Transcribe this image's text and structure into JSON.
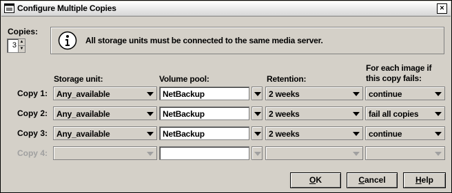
{
  "window": {
    "title": "Configure Multiple Copies",
    "close_glyph": "×"
  },
  "copies": {
    "label": "Copies:",
    "value": "3"
  },
  "info": {
    "message": "All storage units must be connected to the same media server."
  },
  "headers": {
    "storage_unit": "Storage unit:",
    "volume_pool": "Volume pool:",
    "retention": "Retention:",
    "on_fail_line1": "For each image if",
    "on_fail_line2": "this copy fails:"
  },
  "rows": [
    {
      "label": "Copy 1:",
      "storage_unit": "Any_available",
      "volume_pool": "NetBackup",
      "retention": "2 weeks",
      "on_fail": "continue",
      "enabled": true
    },
    {
      "label": "Copy 2:",
      "storage_unit": "Any_available",
      "volume_pool": "NetBackup",
      "retention": "2 weeks",
      "on_fail": "fail all copies",
      "enabled": true
    },
    {
      "label": "Copy 3:",
      "storage_unit": "Any_available",
      "volume_pool": "NetBackup",
      "retention": "2 weeks",
      "on_fail": "continue",
      "enabled": true
    },
    {
      "label": "Copy 4:",
      "storage_unit": "",
      "volume_pool": "",
      "retention": "",
      "on_fail": "",
      "enabled": false
    }
  ],
  "buttons": {
    "ok_mnemonic": "O",
    "ok_rest": "K",
    "cancel_mnemonic": "C",
    "cancel_rest": "ancel",
    "help_mnemonic": "H",
    "help_rest": "elp"
  },
  "colors": {
    "dialog_bg": "#d4d0c8",
    "field_bg": "#ffffff",
    "disabled_text": "#a0a0a0"
  }
}
